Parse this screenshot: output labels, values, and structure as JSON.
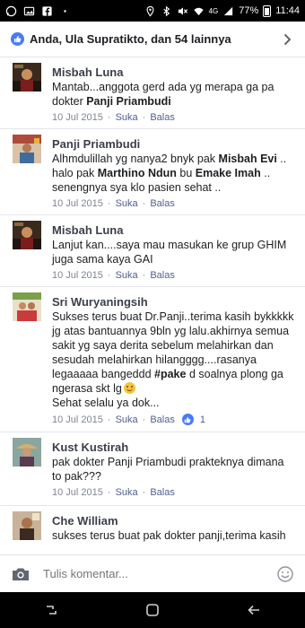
{
  "status_bar": {
    "battery_percent": "77%",
    "time": "11:44",
    "network": "4G",
    "icons": [
      "whatsapp-icon",
      "image-icon",
      "facebook-icon",
      "more-dots-icon",
      "location-icon",
      "bluetooth-icon",
      "mute-icon",
      "wifi-icon",
      "signal-icon",
      "battery-icon"
    ]
  },
  "likes": {
    "text": "Anda, Ula Supratikto, dan 54 lainnya"
  },
  "comments": [
    {
      "author": "Misbah Luna",
      "text_a": "Mantab...anggota gerd ada yg merapa ga pa dokter ",
      "mention_a": "Panji Priambudi",
      "date": "10 Jul 2015",
      "like_label": "Suka",
      "reply_label": "Balas"
    },
    {
      "author": "Panji Priambudi",
      "text_a": "Alhmdulillah yg nanya2 bnyk pak ",
      "mention_a": "Misbah Evi",
      "text_b": " .. halo pak ",
      "mention_b": "Marthino Ndun",
      "text_c": " bu ",
      "mention_c": "Emake Imah",
      "text_d": " .. senengnya sya klo pasien sehat ..",
      "date": "10 Jul 2015",
      "like_label": "Suka",
      "reply_label": "Balas"
    },
    {
      "author": "Misbah Luna",
      "text_a": "Lanjut kan....saya mau masukan ke grup GHIM juga sama kaya GAI",
      "date": "10 Jul 2015",
      "like_label": "Suka",
      "reply_label": "Balas"
    },
    {
      "author": "Sri Wuryaningsih",
      "text_a": "Sukses terus buat Dr.Panji..terima kasih bykkkkk jg atas bantuannya 9bln yg lalu.akhirnya semua sakit yg saya derita sebelum melahirkan dan sesudah melahirkan hilangggg....rasanya legaaaaa bangeddd ",
      "mention_a": "#pake",
      "text_b": " d soalnya plong ga ngerasa skt lg",
      "text_c": "Sehat selalu ya dok...",
      "date": "10 Jul 2015",
      "like_label": "Suka",
      "reply_label": "Balas",
      "reaction_count": "1"
    },
    {
      "author": "Kust Kustirah",
      "text_a": "pak dokter Panji Priambudi prakteknya dimana to pak???",
      "date": "10 Jul 2015",
      "like_label": "Suka",
      "reply_label": "Balas"
    },
    {
      "author": "Che William",
      "text_a": "sukses terus buat pak dokter panji,terima kasih",
      "date": "",
      "like_label": "",
      "reply_label": ""
    }
  ],
  "compose": {
    "placeholder": "Tulis komentar..."
  },
  "colors": {
    "facebook_blue": "#4a7bf0",
    "action_text": "#506090",
    "meta_grey": "#7f8592"
  }
}
